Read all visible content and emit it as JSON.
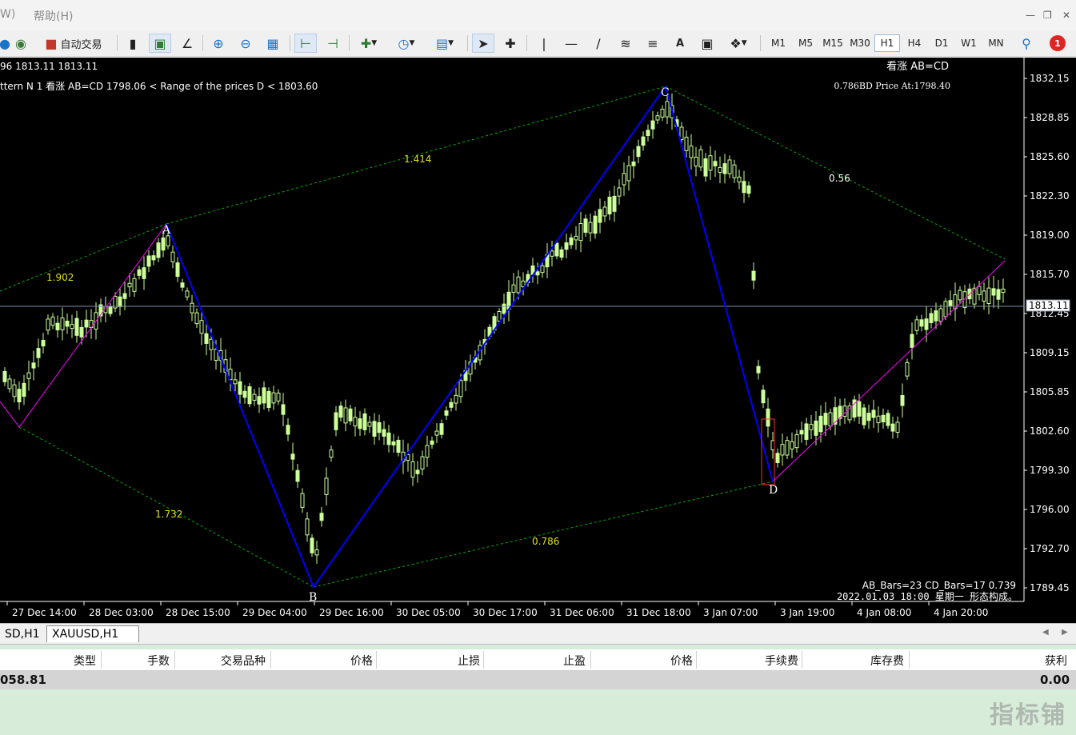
{
  "menu": {
    "left_fragment": "W)",
    "help": "帮助(H)"
  },
  "toolbar": {
    "auto_trade": "自动交易",
    "timeframes": [
      "M1",
      "M5",
      "M15",
      "M30",
      "H1",
      "H4",
      "D1",
      "W1",
      "MN"
    ],
    "selected_timeframe": "H1",
    "notification_count": "1"
  },
  "chart": {
    "info_line": "96 1813.11 1813.11",
    "pattern_line": "ttern N 1 看涨 AB=CD  1798.06 < Range of the prices D < 1803.60",
    "title_right": "看涨 AB=CD",
    "bd_price": "0.786BD Price At:1798.40",
    "bars_info": "AB_Bars=23 CD_Bars=17 0.739",
    "status_line": "2022.01.03 18:00 星期一 形态构成。",
    "current_price": "1813.11",
    "ratios": {
      "r1414": "1.414",
      "r056": "0.56",
      "r1902": "1.902",
      "r1732": "1.732",
      "r0786": "0.786"
    },
    "points": {
      "A": "A",
      "B": "B",
      "C": "C",
      "D": "D"
    },
    "price_labels": [
      "1832.15",
      "1828.85",
      "1825.60",
      "1822.30",
      "1819.00",
      "1815.70",
      "1812.45",
      "1809.15",
      "1805.85",
      "1802.60",
      "1799.30",
      "1796.00",
      "1792.70",
      "1789.45"
    ],
    "time_labels": [
      "27 Dec 14:00",
      "28 Dec 03:00",
      "28 Dec 15:00",
      "29 Dec 04:00",
      "29 Dec 16:00",
      "30 Dec 05:00",
      "30 Dec 17:00",
      "31 Dec 06:00",
      "31 Dec 18:00",
      "3 Jan 07:00",
      "3 Jan 19:00",
      "4 Jan 08:00",
      "4 Jan 20:00"
    ],
    "colors": {
      "background": "#000000",
      "candle": "#ccff99",
      "pattern": "#0000ff",
      "leg": "#ff00ff",
      "fib": "#00c000",
      "axis": "#ffffff"
    }
  },
  "tabs": [
    "SD,H1",
    "XAUUSD,H1"
  ],
  "terminal": {
    "columns": [
      "类型",
      "手数",
      "交易品种",
      "价格",
      "止损",
      "止盈",
      "价格",
      "手续费",
      "库存费",
      "获利"
    ],
    "balance_fragment": "058.81",
    "profit": "0.00"
  },
  "watermark": "指标铺"
}
